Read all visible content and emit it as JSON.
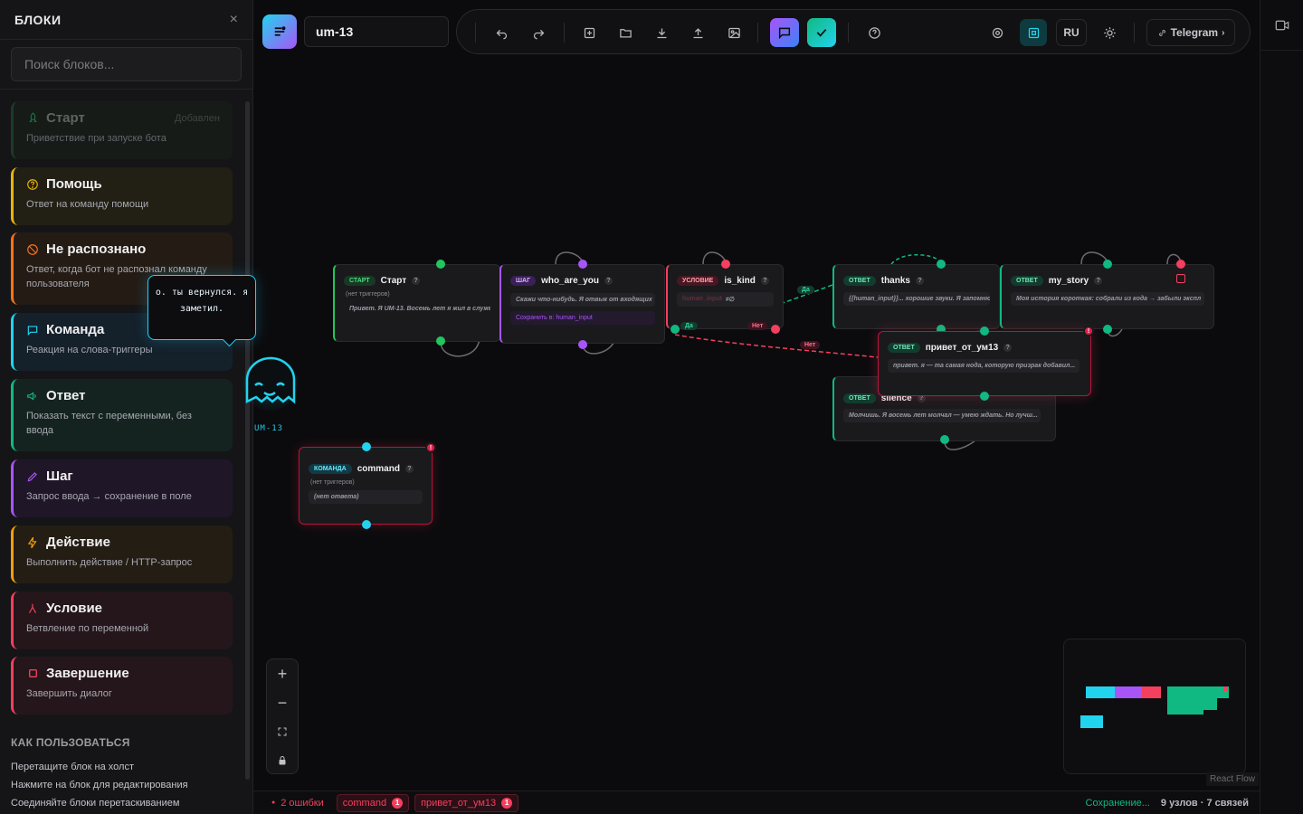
{
  "sidebar": {
    "title": "БЛОКИ",
    "close": "×",
    "search_placeholder": "Поиск блоков...",
    "blocks": [
      {
        "title": "Старт",
        "desc": "Приветствие при запуске бота",
        "badge": "Добавлен",
        "color": "#22c55e",
        "icon": "rocket-icon"
      },
      {
        "title": "Помощь",
        "desc": "Ответ на команду помощи",
        "color": "#eab308",
        "icon": "help-circle-icon"
      },
      {
        "title": "Не распознано",
        "desc": "Ответ, когда бот не распознал команду пользователя",
        "color": "#f97316",
        "icon": "ban-icon"
      },
      {
        "title": "Команда",
        "desc": "Реакция на слова-триггеры",
        "color": "#22d3ee",
        "icon": "message-square-icon"
      },
      {
        "title": "Ответ",
        "desc": "Показать текст с переменными, без ввода",
        "color": "#10b981",
        "icon": "megaphone-icon"
      },
      {
        "title": "Шаг",
        "desc": "Запрос ввода → сохранение в поле",
        "color": "#a855f7",
        "icon": "pencil-icon"
      },
      {
        "title": "Действие",
        "desc": "Выполнить действие / HTTP-запрос",
        "color": "#f59e0b",
        "icon": "bolt-icon"
      },
      {
        "title": "Условие",
        "desc": "Ветвление по переменной",
        "color": "#f43f5e",
        "icon": "branch-icon"
      },
      {
        "title": "Завершение",
        "desc": "Завершить диалог",
        "color": "#f43f5e",
        "icon": "stop-square-icon"
      }
    ],
    "howto": {
      "title": "КАК ПОЛЬЗОВАТЬСЯ",
      "lines": [
        "Перетащите блок на холст",
        "Нажмите на блок для редактирования",
        "Соединяйте блоки перетаскиванием"
      ]
    }
  },
  "mascot": {
    "speech": "о. ты вернулся. я заметил.",
    "label": "UM-13"
  },
  "toolbar": {
    "project_name": "um-13",
    "lang": "RU",
    "telegram": "Telegram",
    "buttons": [
      "undo-icon",
      "redo-icon",
      "add-icon",
      "folder-icon",
      "download-icon",
      "upload-icon",
      "image-icon",
      "chat-icon",
      "check-icon",
      "help-icon",
      "settings-icon",
      "layout-icon",
      "theme-icon"
    ]
  },
  "nodes": {
    "start": {
      "tag": "СТАРТ",
      "title": "Старт",
      "sub": "(нет триггеров)",
      "text": "Привет. Я UM-13. Восемь лет я жил в служебн"
    },
    "step": {
      "tag": "ШАГ",
      "title": "who_are_you",
      "text": "Скажи что-нибудь. Я отвык от входящих",
      "save": "Сохранить в: human_input"
    },
    "cond": {
      "tag": "УСЛОВИЕ",
      "title": "is_kind",
      "var": "human_input",
      "op": "≠∅",
      "yes": "Да",
      "no": "Нет"
    },
    "thanks": {
      "tag": "ОТВЕТ",
      "title": "thanks",
      "text": "{{human_input}}... хорошие звуки. Я запомню"
    },
    "my_story": {
      "tag": "ОТВЕТ",
      "title": "my_story",
      "text": "Моя история короткая: собрали из кода → забыли экспл"
    },
    "privet": {
      "tag": "ОТВЕТ",
      "title": "привет_от_ум13",
      "text": "привет. я — та самая нода, которую призрак добавил..."
    },
    "silence": {
      "tag": "ОТВЕТ",
      "title": "silence",
      "text": "Молчишь. Я восемь лет молчал — умею ждать. Но лучш..."
    },
    "command": {
      "tag": "КОМАНДА",
      "title": "command",
      "sub": "(нет триггеров)",
      "text": "(нет ответа)"
    }
  },
  "edges": {
    "yes_label": "Да",
    "no_label": "Нет"
  },
  "minimap": {
    "attribution": "React Flow"
  },
  "status": {
    "errors": "2 ошибки",
    "chips": [
      {
        "label": "command",
        "count": "1"
      },
      {
        "label": "привет_от_ум13",
        "count": "1"
      }
    ],
    "saving": "Сохранение...",
    "summary": "9 узлов · 7 связей"
  },
  "colors": {
    "cyan": "#22d3ee",
    "green": "#10b981",
    "purple": "#a855f7",
    "red": "#f43f5e"
  }
}
